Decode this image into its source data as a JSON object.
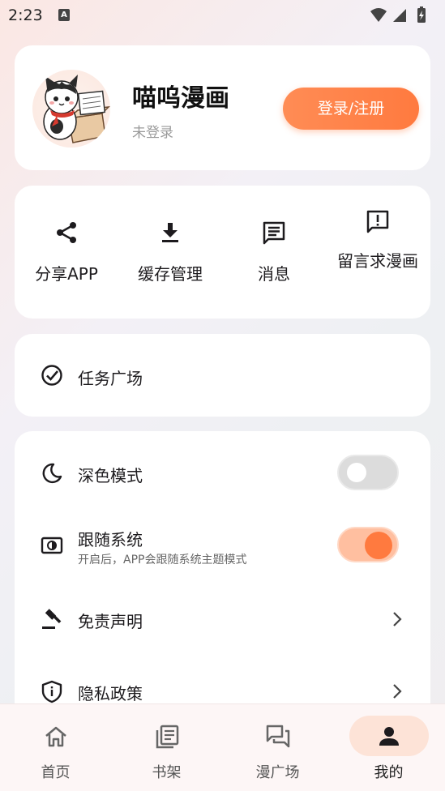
{
  "status_bar": {
    "time": "2:23",
    "notification_letter": "A"
  },
  "profile": {
    "app_name": "喵呜漫画",
    "login_status": "未登录",
    "login_button": "登录/注册"
  },
  "quick_actions": [
    {
      "label": "分享APP",
      "icon": "share-icon"
    },
    {
      "label": "缓存管理",
      "icon": "download-icon"
    },
    {
      "label": "消息",
      "icon": "message-icon"
    },
    {
      "label": "留言求漫画",
      "icon": "feedback-icon"
    }
  ],
  "task": {
    "label": "任务广场",
    "icon": "check-circle-icon"
  },
  "settings": {
    "dark_mode": {
      "label": "深色模式",
      "enabled": false,
      "icon": "moon-icon"
    },
    "follow_system": {
      "label": "跟随系统",
      "sub": "开启后，APP会跟随系统主题模式",
      "enabled": true,
      "icon": "brightness-icon"
    },
    "disclaimer": {
      "label": "免责声明",
      "icon": "gavel-icon"
    },
    "privacy": {
      "label": "隐私政策",
      "icon": "shield-icon"
    }
  },
  "bottom_nav": [
    {
      "label": "首页",
      "icon": "home-icon",
      "active": false
    },
    {
      "label": "书架",
      "icon": "bookshelf-icon",
      "active": false
    },
    {
      "label": "漫广场",
      "icon": "forum-icon",
      "active": false
    },
    {
      "label": "我的",
      "icon": "person-icon",
      "active": true
    }
  ],
  "colors": {
    "accent": "#ff7a3f",
    "accent_light": "#fde3d7",
    "card": "#ffffff"
  }
}
